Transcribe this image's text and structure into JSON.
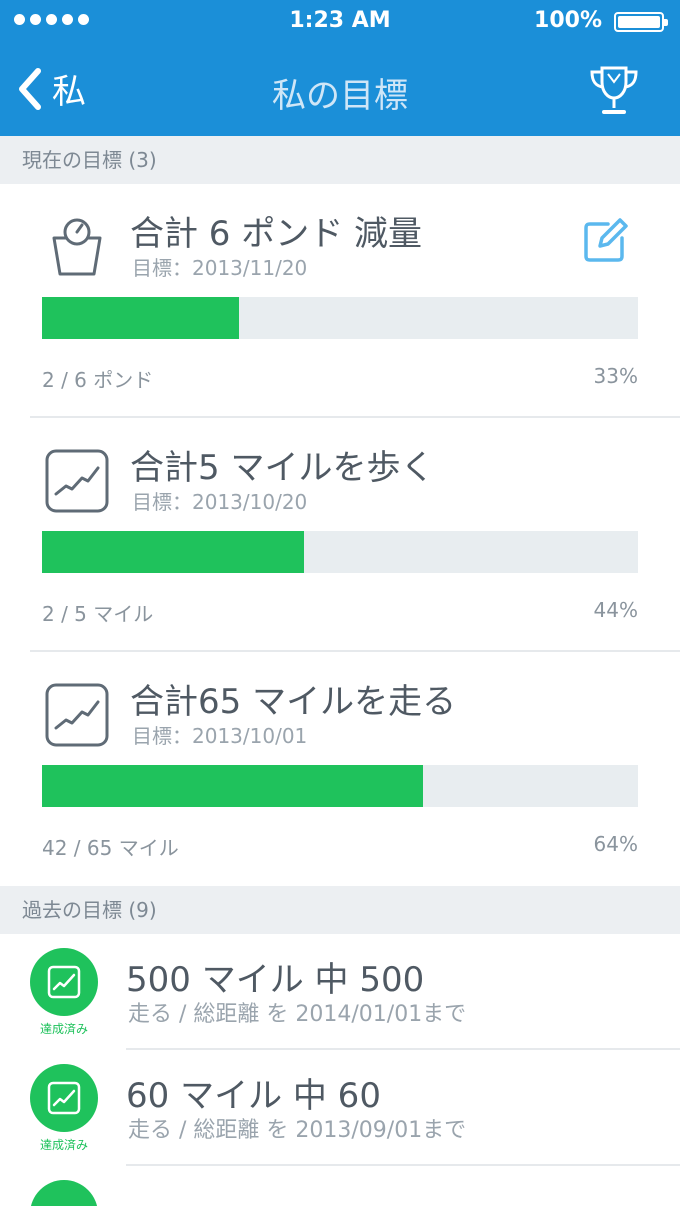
{
  "status_bar": {
    "time": "1:23 AM",
    "battery": "100%"
  },
  "nav": {
    "back_label": "私",
    "title": "私の目標"
  },
  "current_header": "現在の目標 (3)",
  "past_header": "過去の目標 (9)",
  "current_goals": [
    {
      "title": "合計 6 ポンド 減量",
      "date": "目標：2013/11/20",
      "progress_text": "2 / 6 ポンド",
      "percent_text": "33%",
      "fraction": 0.33,
      "icon": "weight-scale-icon"
    },
    {
      "title": "合計5 マイルを歩く",
      "date": "目標：2013/10/20",
      "progress_text": "2 / 5 マイル",
      "percent_text": "44%",
      "fraction": 0.44,
      "icon": "trend-chart-icon"
    },
    {
      "title": "合計65 マイルを走る",
      "date": "目標：2013/10/01",
      "progress_text": "42 / 65 マイル",
      "percent_text": "64%",
      "fraction": 0.64,
      "icon": "trend-chart-icon"
    }
  ],
  "past_goals": [
    {
      "title": "500 マイル 中 500",
      "subtitle": "走る / 総距離 を 2014/01/01まで",
      "badge": "達成済み"
    },
    {
      "title": "60 マイル 中 60",
      "subtitle": "走る / 総距離 を 2013/09/01まで",
      "badge": "達成済み"
    }
  ],
  "colors": {
    "nav_blue": "#1b8fd8",
    "progress_green": "#1fc25c",
    "track_gray": "#e8edf0",
    "edit_blue": "#5bb8ee"
  }
}
